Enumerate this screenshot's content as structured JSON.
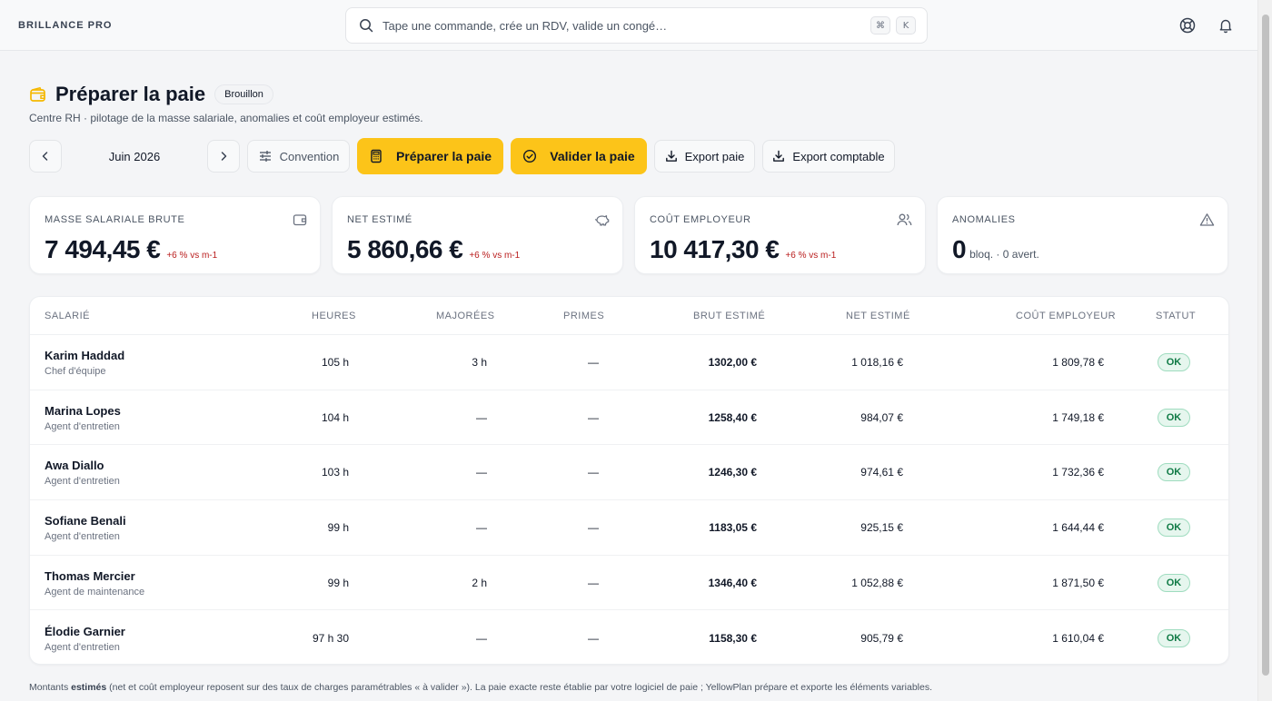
{
  "app": {
    "brand": "BRILLANCE PRO"
  },
  "search": {
    "placeholder": "Tape une commande, crée un RDV, valide un congé…",
    "kbd1": "⌘",
    "kbd2": "K"
  },
  "header": {
    "title": "Préparer la paie",
    "status_badge": "Brouillon",
    "subtitle": "Centre RH · pilotage de la masse salariale, anomalies et coût employeur estimés."
  },
  "toolbar": {
    "month": "Juin 2026",
    "convention": "Convention",
    "prepare": "Préparer la paie",
    "validate": "Valider la paie",
    "export_paie": "Export paie",
    "export_comptable": "Export comptable"
  },
  "kpis": [
    {
      "label": "Masse salariale brute",
      "value": "7 494,45 €",
      "delta": "+6 % vs m-1",
      "icon": "wallet-icon"
    },
    {
      "label": "Net estimé",
      "value": "5 860,66 €",
      "delta": "+6 % vs m-1",
      "icon": "piggy-bank-icon"
    },
    {
      "label": "Coût employeur",
      "value": "10 417,30 €",
      "delta": "+6 % vs m-1",
      "icon": "users-icon"
    },
    {
      "label": "Anomalies",
      "value": "0",
      "suffix": "bloq. · 0 avert.",
      "icon": "warning-icon"
    }
  ],
  "table": {
    "headers": {
      "employee": "Salarié",
      "hours": "Heures",
      "overtime": "Majorées",
      "bonuses": "Primes",
      "gross": "Brut estimé",
      "net": "Net estimé",
      "cost": "Coût employeur",
      "status": "Statut"
    },
    "rows": [
      {
        "name": "Karim Haddad",
        "role": "Chef d'équipe",
        "hours": "105 h",
        "overtime": "3 h",
        "bonuses": "—",
        "gross": "1302,00 €",
        "net": "1 018,16 €",
        "cost": "1 809,78 €",
        "status": "OK"
      },
      {
        "name": "Marina Lopes",
        "role": "Agent d'entretien",
        "hours": "104 h",
        "overtime": "—",
        "bonuses": "—",
        "gross": "1258,40 €",
        "net": "984,07 €",
        "cost": "1 749,18 €",
        "status": "OK"
      },
      {
        "name": "Awa Diallo",
        "role": "Agent d'entretien",
        "hours": "103 h",
        "overtime": "—",
        "bonuses": "—",
        "gross": "1246,30 €",
        "net": "974,61 €",
        "cost": "1 732,36 €",
        "status": "OK"
      },
      {
        "name": "Sofiane Benali",
        "role": "Agent d'entretien",
        "hours": "99 h",
        "overtime": "—",
        "bonuses": "—",
        "gross": "1183,05 €",
        "net": "925,15 €",
        "cost": "1 644,44 €",
        "status": "OK"
      },
      {
        "name": "Thomas Mercier",
        "role": "Agent de maintenance",
        "hours": "99 h",
        "overtime": "2 h",
        "bonuses": "—",
        "gross": "1346,40 €",
        "net": "1 052,88 €",
        "cost": "1 871,50 €",
        "status": "OK"
      },
      {
        "name": "Élodie Garnier",
        "role": "Agent d'entretien",
        "hours": "97 h 30",
        "overtime": "—",
        "bonuses": "—",
        "gross": "1158,30 €",
        "net": "905,79 €",
        "cost": "1 610,04 €",
        "status": "OK"
      }
    ]
  },
  "footer": {
    "prefix": "Montants",
    "emphasis": "estimés",
    "text": "(net et coût employeur reposent sur des taux de charges paramétrables « à valider »). La paie exacte reste établie par votre logiciel de paie ; YellowPlan prépare et exporte les éléments variables."
  },
  "colors": {
    "accent": "#fcc419",
    "delta": "#b91c1c",
    "ok_bg": "#e6f6ee",
    "ok_text": "#0f7a45"
  }
}
